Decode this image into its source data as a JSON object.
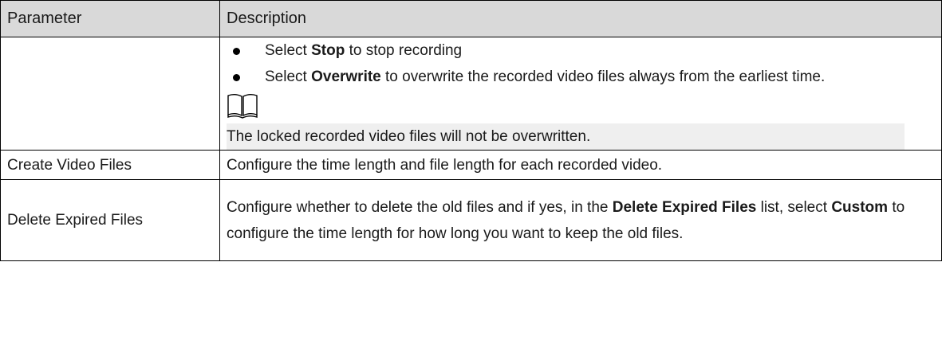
{
  "header": {
    "parameter": "Parameter",
    "description": "Description"
  },
  "rows": {
    "storage_full": {
      "bullet1": {
        "pre": "Select ",
        "bold": "Stop",
        "post": " to stop recording"
      },
      "bullet2": {
        "pre": "Select ",
        "bold": "Overwrite",
        "post": " to overwrite the recorded video files always from the earliest time."
      },
      "note_icon": "book-note-icon",
      "note": "The locked recorded video files will not be overwritten."
    },
    "create_video_files": {
      "parameter": "Create Video Files",
      "description": "Configure the time length and file length for each recorded video."
    },
    "delete_expired_files": {
      "parameter": "Delete Expired Files",
      "desc_part1": "Configure whether to delete the old files and if yes, in the ",
      "desc_bold1": "Delete Expired Files",
      "desc_part2": " list, select ",
      "desc_bold2": "Custom",
      "desc_part3": " to configure the time length for how long you want to keep the old files."
    }
  }
}
